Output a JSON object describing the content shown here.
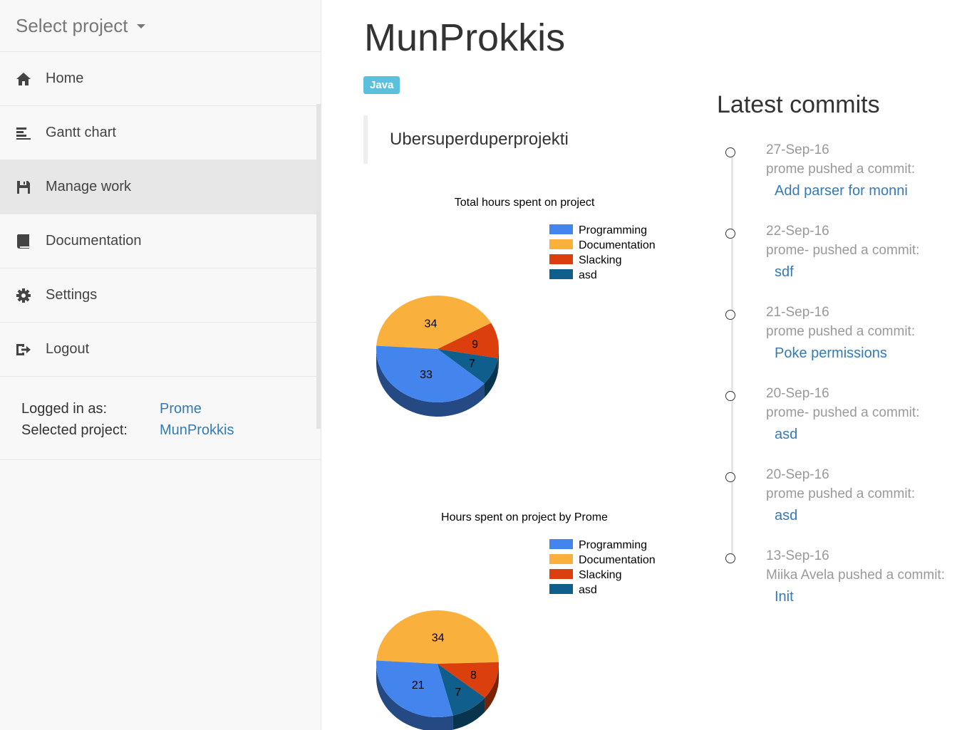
{
  "sidebar": {
    "select_project": "Select project",
    "items": [
      {
        "label": "Home",
        "icon": "home-icon"
      },
      {
        "label": "Gantt chart",
        "icon": "gantt-icon"
      },
      {
        "label": "Manage work",
        "icon": "save-icon",
        "active": true
      },
      {
        "label": "Documentation",
        "icon": "book-icon"
      },
      {
        "label": "Settings",
        "icon": "gear-icon"
      },
      {
        "label": "Logout",
        "icon": "logout-icon"
      }
    ],
    "info": {
      "logged_in_label": "Logged in as:",
      "logged_in_value": "Prome",
      "selected_project_label": "Selected project:",
      "selected_project_value": "MunProkkis"
    }
  },
  "main": {
    "title": "MunProkkis",
    "badge": "Java",
    "description": "Ubersuperduperprojekti"
  },
  "chart_data": [
    {
      "type": "pie",
      "title": "Total hours spent on project",
      "categories": [
        "Programming",
        "Documentation",
        "Slacking",
        "asd"
      ],
      "values": [
        33,
        34,
        9,
        7
      ],
      "colors": [
        "#4385ec",
        "#fab03d",
        "#db3f0e",
        "#0f5e8c"
      ]
    },
    {
      "type": "pie",
      "title": "Hours spent on project by Prome",
      "categories": [
        "Programming",
        "Documentation",
        "Slacking",
        "asd"
      ],
      "values": [
        21,
        34,
        8,
        7
      ],
      "colors": [
        "#4385ec",
        "#fab03d",
        "#db3f0e",
        "#0f5e8c"
      ]
    }
  ],
  "commits": {
    "title": "Latest commits",
    "items": [
      {
        "date": "27-Sep-16",
        "author": "prome pushed a commit:",
        "message": "Add parser for monni"
      },
      {
        "date": "22-Sep-16",
        "author": "prome- pushed a commit:",
        "message": "sdf"
      },
      {
        "date": "21-Sep-16",
        "author": "prome pushed a commit:",
        "message": "Poke permissions"
      },
      {
        "date": "20-Sep-16",
        "author": "prome- pushed a commit:",
        "message": "asd"
      },
      {
        "date": "20-Sep-16",
        "author": "prome pushed a commit:",
        "message": "asd"
      },
      {
        "date": "13-Sep-16",
        "author": "Miika Avela pushed a commit:",
        "message": "Init"
      }
    ]
  }
}
